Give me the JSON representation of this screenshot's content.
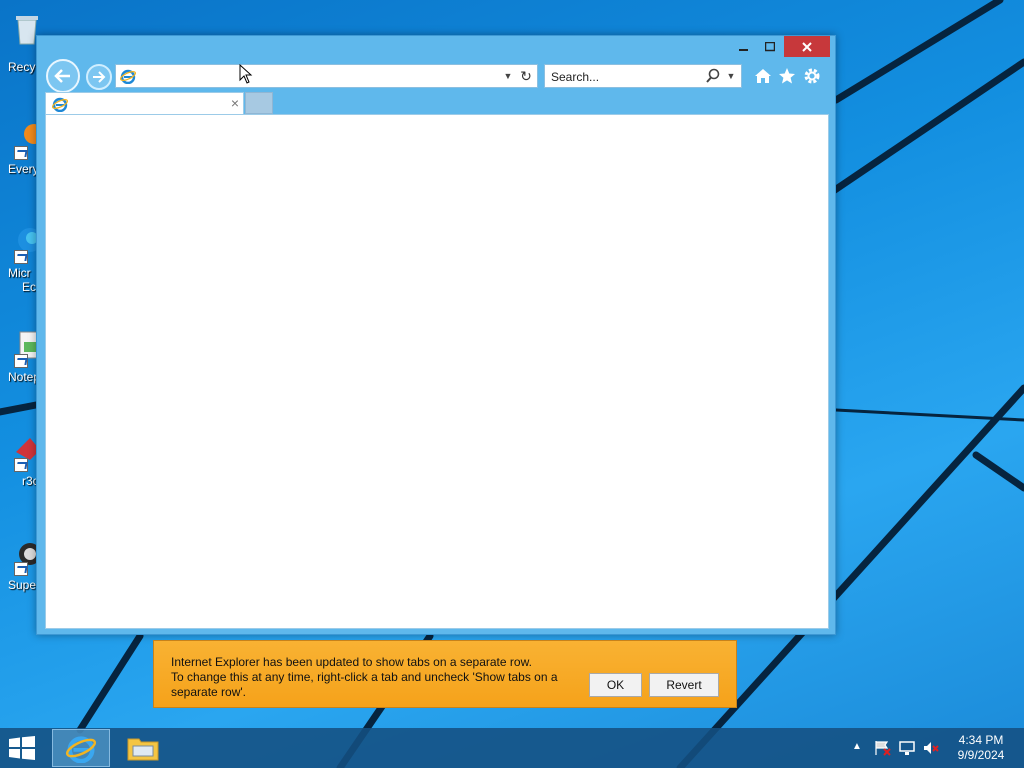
{
  "desktop": {
    "icons": [
      {
        "label": "Recyc"
      },
      {
        "label": "Every"
      },
      {
        "label": "Micr"
      },
      {
        "label": "Ec"
      },
      {
        "label": "Notep"
      },
      {
        "label": "r3c"
      },
      {
        "label": "Super"
      }
    ]
  },
  "browser": {
    "address_value": "",
    "search_placeholder": "Search...",
    "tab_title": ""
  },
  "notification": {
    "line1": "Internet Explorer has been updated to show tabs on a separate row.",
    "line2": "To change this at any time, right-click a tab and uncheck 'Show tabs on a separate row'.",
    "ok_label": "OK",
    "revert_label": "Revert"
  },
  "taskbar": {
    "time": "4:34 PM",
    "date": "9/9/2024"
  },
  "colors": {
    "window_frame": "#5fb8ec",
    "close_button": "#c7383b",
    "notification_bg": "#f5a21a",
    "taskbar": "#14507f"
  },
  "icons": {
    "close": "close-icon",
    "search": "search-icon",
    "home": "home-icon",
    "favorites": "star-icon",
    "tools": "gear-icon"
  }
}
